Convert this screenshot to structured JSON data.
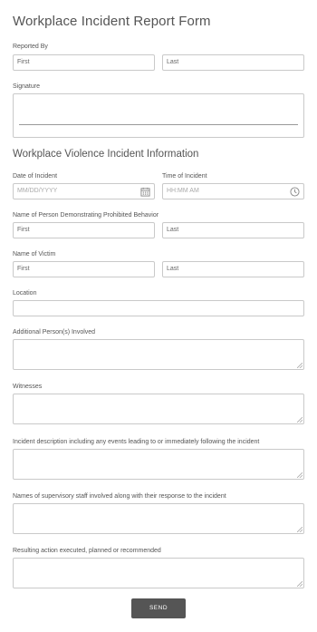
{
  "form": {
    "title": "Workplace Incident Report Form",
    "reported_by": {
      "label": "Reported By",
      "first_placeholder": "First",
      "last_placeholder": "Last"
    },
    "signature": {
      "label": "Signature"
    },
    "section_title": "Workplace Violence Incident Information",
    "date_of_incident": {
      "label": "Date of Incident",
      "placeholder": "MM/DD/YYYY",
      "icon": "calendar-icon"
    },
    "time_of_incident": {
      "label": "Time of Incident",
      "placeholder": "HH:MM AM",
      "icon": "clock-icon"
    },
    "person_prohibited": {
      "label": "Name of Person Demonstrating Prohibited Behavior",
      "first_placeholder": "First",
      "last_placeholder": "Last"
    },
    "victim": {
      "label": "Name of Victim",
      "first_placeholder": "First",
      "last_placeholder": "Last"
    },
    "location": {
      "label": "Location"
    },
    "additional_persons": {
      "label": "Additional Person(s) Involved"
    },
    "witnesses": {
      "label": "Witnesses"
    },
    "description": {
      "label": "Incident description including any events leading to or immediately following the incident"
    },
    "supervisory": {
      "label": "Names of supervisory staff involved along with their response to the incident"
    },
    "resulting_action": {
      "label": "Resulting action executed, planned or recommended"
    },
    "send_label": "SEND"
  }
}
